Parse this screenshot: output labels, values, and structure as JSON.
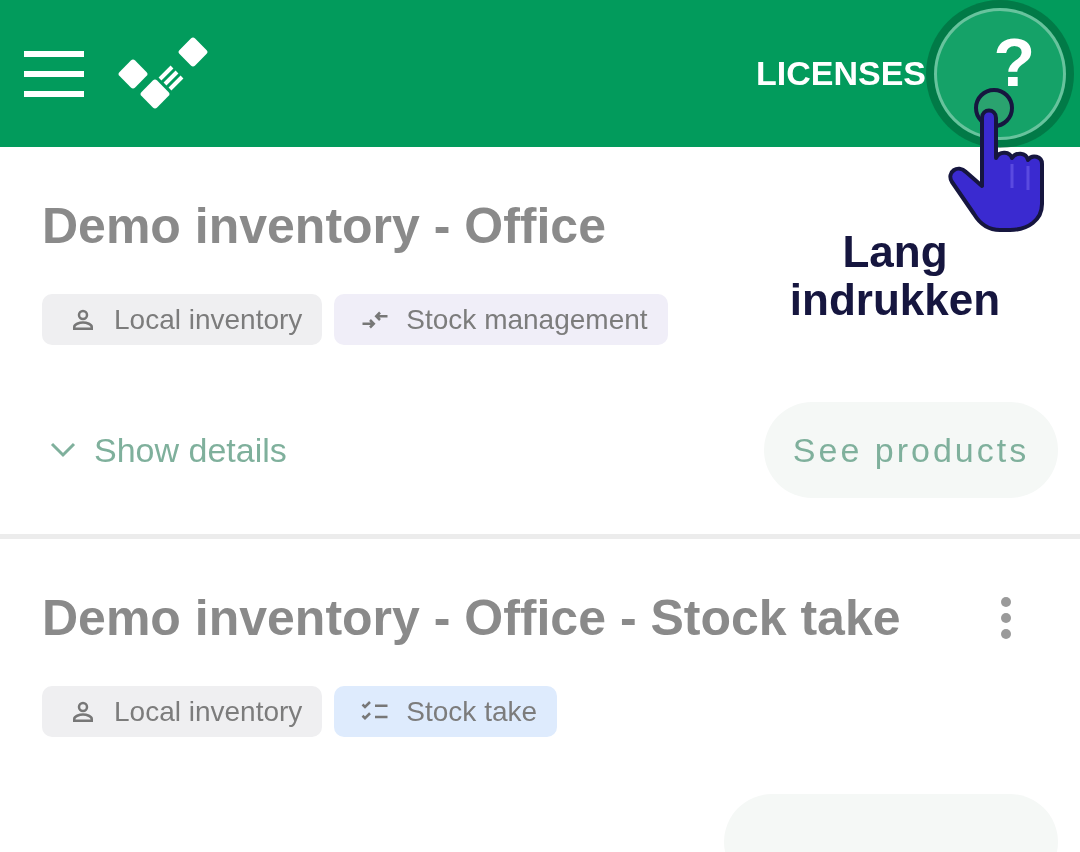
{
  "app_bar": {
    "action": "LICENSES",
    "help": "?"
  },
  "tutorial": {
    "hint": "Lang indrukken"
  },
  "inventories": [
    {
      "title": "Demo inventory - Office",
      "tags": [
        {
          "label": "Local inventory",
          "kind": "local"
        },
        {
          "label": "Stock management",
          "kind": "stock_management"
        }
      ],
      "details_toggle": "Show details",
      "button": "See products"
    },
    {
      "title": "Demo inventory - Office - Stock take",
      "tags": [
        {
          "label": "Local inventory",
          "kind": "local"
        },
        {
          "label": "Stock take",
          "kind": "stock_take"
        }
      ]
    }
  ]
}
